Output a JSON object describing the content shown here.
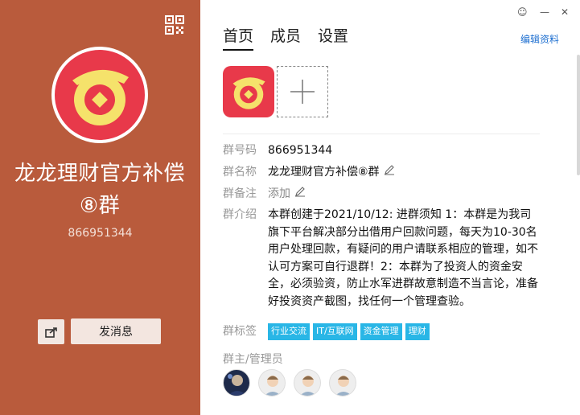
{
  "left": {
    "title": "龙龙理财官方补偿⑧群",
    "group_id": "866951344",
    "send_button": "发消息",
    "qr_icon": "qr-code-icon",
    "share_icon": "share-icon"
  },
  "tabs": [
    "首页",
    "成员",
    "设置"
  ],
  "edit_link": "编辑资料",
  "info": {
    "id_label": "群号码",
    "id_value": "866951344",
    "name_label": "群名称",
    "name_value": "龙龙理财官方补偿⑧群",
    "note_label": "群备注",
    "note_value": "添加",
    "intro_label": "群介绍",
    "intro_value": "本群创建于2021/10/12: 进群须知 1：本群是为我司旗下平台解决部分出借用户回款问题，每天为10-30名用户处理回款，有疑问的用户请联系相应的管理，如不认可方案可自行退群！2：本群为了投资人的资金安全，必须验资，防止水军进群故意制造不当言论，准备好投资资产截图，找任何一个管理查验。",
    "tags_label": "群标签",
    "tags": [
      "行业交流",
      "IT/互联网",
      "资金管理",
      "理财"
    ]
  },
  "admins_label": "群主/管理员",
  "colors": {
    "left_bg": "#b95b3c",
    "tag_bg": "#29b6e6",
    "logo_red": "#e8394a",
    "logo_yellow": "#f5e26b"
  }
}
